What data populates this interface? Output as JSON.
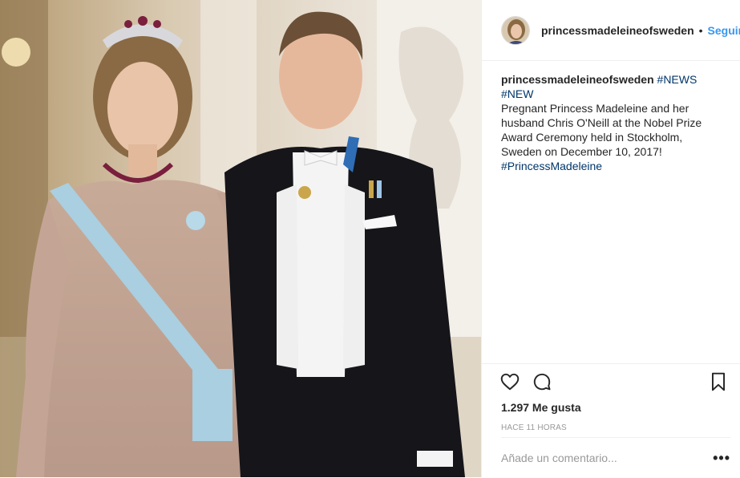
{
  "post": {
    "username": "princessmadeleineofsweden",
    "dot": "•",
    "follow_label": "Seguir",
    "caption": {
      "username": "princessmadeleineofsweden",
      "tag_news": "#NEWS",
      "tag_new": "#NEW",
      "text": "Pregnant Princess Madeleine and her husband Chris O'Neill at the Nobel Prize Award Ceremony held in Stockholm, Sweden on December 10, 2017!",
      "tag_madeleine": "#PrincessMadeleine"
    },
    "likes": "1.297 Me gusta",
    "time": "HACE 11 HORAS",
    "comment_placeholder": "Añade un comentario...",
    "more_label": "•••"
  },
  "icons": {
    "like": "heart-icon",
    "comment": "speech-bubble-icon",
    "save": "bookmark-icon",
    "more": "ellipsis-icon"
  },
  "colors": {
    "link": "#3897f0",
    "hashtag": "#003569",
    "border": "#efefef",
    "muted": "#999999"
  }
}
